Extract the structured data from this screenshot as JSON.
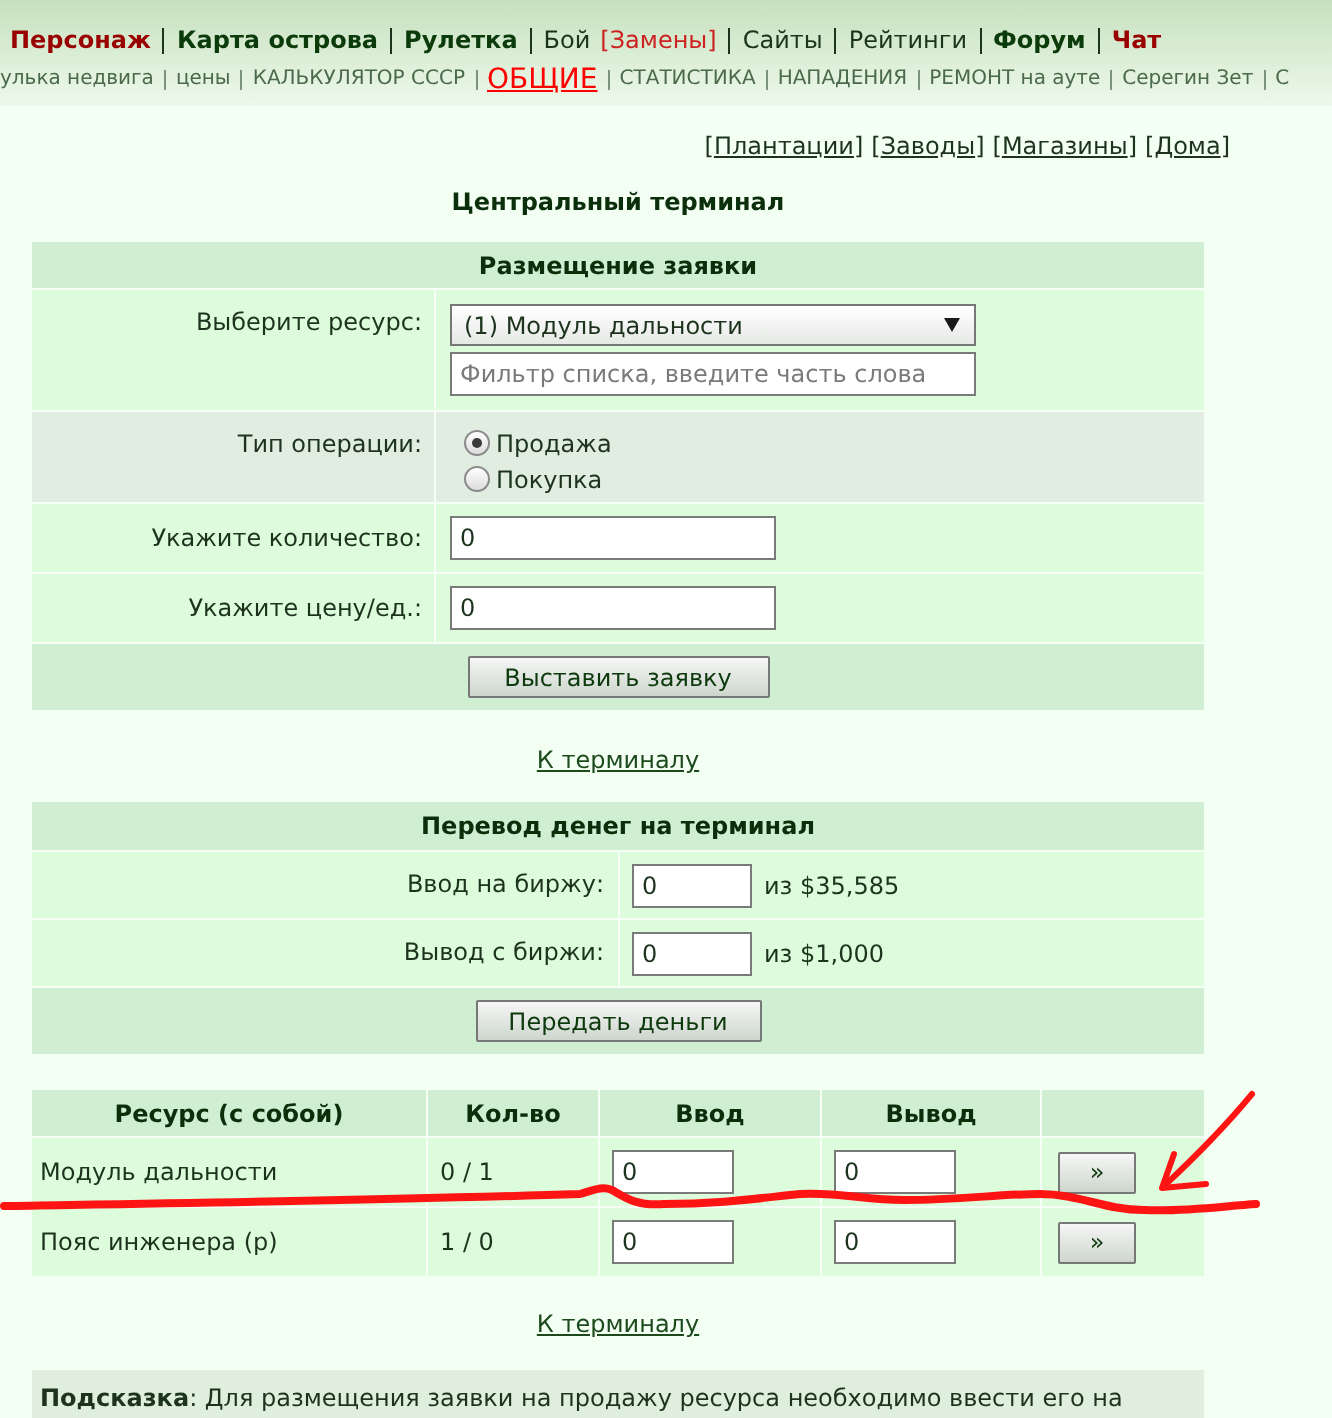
{
  "nav_primary": [
    {
      "links": [
        {
          "label": "Персонаж",
          "bold": true,
          "color": "#990000"
        }
      ]
    },
    {
      "links": [
        {
          "label": "Карта острова",
          "bold": true,
          "color": "#0b3a0b"
        }
      ]
    },
    {
      "links": [
        {
          "label": "Рулетка",
          "bold": true,
          "color": "#0b3a0b"
        }
      ]
    },
    {
      "links": [
        {
          "label": "Бой",
          "bold": false,
          "color": "#1d331d"
        },
        {
          "label": "[Замены]",
          "bold": false,
          "color": "#cc2222"
        }
      ]
    },
    {
      "links": [
        {
          "label": "Сайты",
          "bold": false,
          "color": "#1d331d"
        }
      ]
    },
    {
      "links": [
        {
          "label": "Рейтинги",
          "bold": false,
          "color": "#1d331d"
        }
      ]
    },
    {
      "links": [
        {
          "label": "Форум",
          "bold": true,
          "color": "#0b3a0b"
        }
      ]
    },
    {
      "links": [
        {
          "label": "Чат",
          "bold": true,
          "color": "#990000"
        }
      ]
    }
  ],
  "nav_secondary": [
    {
      "label": "улька недвига",
      "selected": false
    },
    {
      "label": "цены",
      "selected": false
    },
    {
      "label": "КАЛЬКУЛЯТОР СССР",
      "selected": false
    },
    {
      "label": "ОБЩИЕ",
      "selected": true
    },
    {
      "label": "СТАТИСТИКА",
      "selected": false
    },
    {
      "label": "НАПАДЕНИЯ",
      "selected": false
    },
    {
      "label": "РЕМОНТ на ауте",
      "selected": false
    },
    {
      "label": "Серегин Зет",
      "selected": false
    },
    {
      "label": "С",
      "selected": false
    }
  ],
  "section_links": [
    "[Плантации]",
    "[Заводы]",
    "[Магазины]",
    "[Дома]"
  ],
  "title": "Центральный терминал",
  "order_form": {
    "title": "Размещение заявки",
    "resource": {
      "label": "Выберите ресурс:",
      "value": "(1) Модуль дальности",
      "filter_placeholder": "Фильтр списка, введите часть слова"
    },
    "operation": {
      "label": "Тип операции:",
      "options": [
        {
          "label": "Продажа",
          "selected": true
        },
        {
          "label": "Покупка",
          "selected": false
        }
      ]
    },
    "quantity": {
      "label": "Укажите количество:",
      "value": "0"
    },
    "price": {
      "label": "Укажите цену/ед.:",
      "value": "0"
    },
    "submit": "Выставить заявку"
  },
  "back_link_1": "К терминалу",
  "transfer": {
    "title": "Перевод денег на терминал",
    "rows": [
      {
        "label": "Ввод на биржу:",
        "value": "0",
        "available": "из $35,585"
      },
      {
        "label": "Вывод с биржи:",
        "value": "0",
        "available": "из $1,000"
      }
    ],
    "submit": "Передать деньги"
  },
  "resources": {
    "columns": [
      "Ресурс (с собой)",
      "Кол-во",
      "Ввод",
      "Вывод"
    ],
    "rows": [
      {
        "name": "Модуль дальности",
        "quantity": "0 / 1",
        "input": "0",
        "output": "0",
        "button": "»",
        "hand_marked": true
      },
      {
        "name": "Пояс инженера (р)",
        "quantity": "1 / 0",
        "input": "0",
        "output": "0",
        "button": "»",
        "hand_marked": false
      }
    ]
  },
  "back_link_2": "К терминалу",
  "hint": {
    "text": "**Подсказка**: Для размещения заявки на продажу ресурса необходимо ввести его на"
  }
}
